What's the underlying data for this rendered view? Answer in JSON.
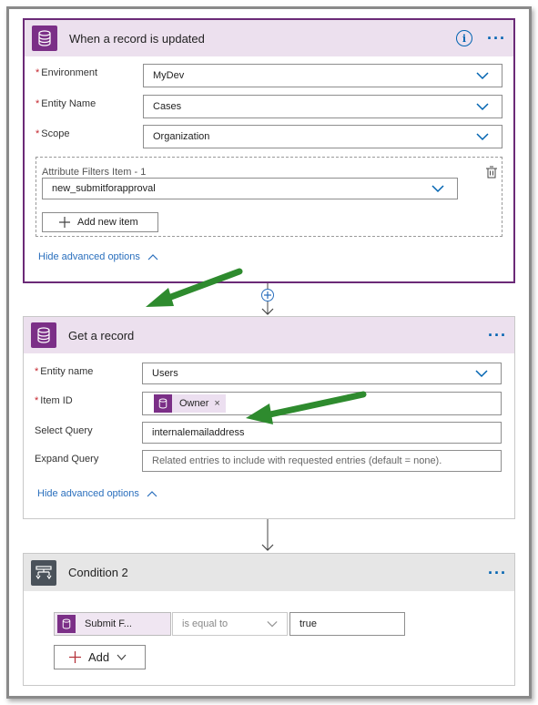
{
  "trigger": {
    "title": "When a record is updated",
    "fields": [
      {
        "label": "Environment",
        "value": "MyDev"
      },
      {
        "label": "Entity Name",
        "value": "Cases"
      },
      {
        "label": "Scope",
        "value": "Organization"
      }
    ],
    "attribute_filters": {
      "label": "Attribute Filters Item - 1",
      "value": "new_submitforapproval",
      "add_button": "Add new item"
    },
    "advanced_link": "Hide advanced options"
  },
  "get_record": {
    "title": "Get a record",
    "entity_label": "Entity name",
    "entity_value": "Users",
    "item_id_label": "Item ID",
    "item_id_token": "Owner",
    "token_close": "×",
    "select_label": "Select Query",
    "select_value": "internalemailaddress",
    "expand_label": "Expand Query",
    "expand_placeholder": "Related entries to include with requested entries (default = none).",
    "advanced_link": "Hide advanced options"
  },
  "condition": {
    "title": "Condition 2",
    "left_token": "Submit F...",
    "operator": "is equal to",
    "right_value": "true",
    "add_button": "Add"
  },
  "colors": {
    "accent": "#6b2a77",
    "link": "#2a6fbd",
    "arrow": "#2e8b2e"
  }
}
